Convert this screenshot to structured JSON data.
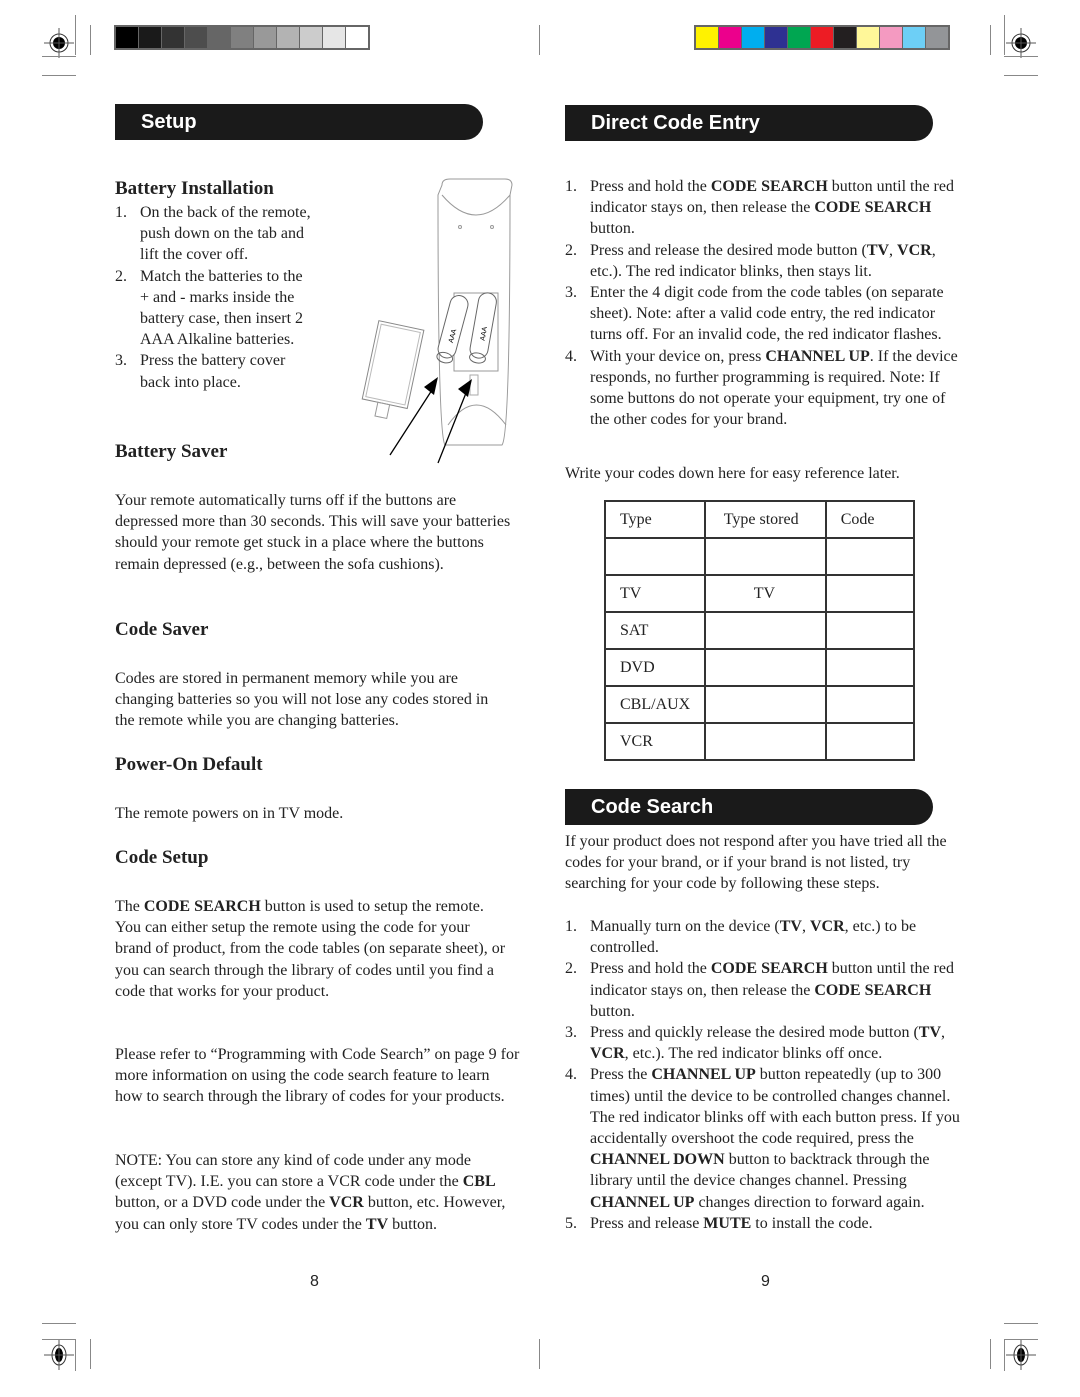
{
  "color_bars": {
    "grayscale": [
      "#000000",
      "#1a1a1a",
      "#333333",
      "#4d4d4d",
      "#666666",
      "#808080",
      "#999999",
      "#b3b3b3",
      "#cccccc",
      "#e6e6e6",
      "#ffffff"
    ],
    "process": [
      "#fff200",
      "#ec008c",
      "#00aeef",
      "#2e3192",
      "#00a651",
      "#ed1c24",
      "#231f20",
      "#fff799",
      "#f49ac1",
      "#6dcff6",
      "#939598"
    ]
  },
  "left_page": {
    "header": "Setup",
    "battery_installation": {
      "title": "Battery Installation",
      "steps": [
        {
          "num": "1.",
          "lines": [
            "On the back of the remote,",
            "push down on the tab and",
            "lift the cover off."
          ]
        },
        {
          "num": "2.",
          "lines": [
            "Match the batteries to the",
            "+ and - marks inside the",
            "battery case, then insert 2",
            "AAA Alkaline batteries."
          ]
        },
        {
          "num": "3.",
          "lines": [
            "Press the battery cover",
            "back into place."
          ]
        }
      ],
      "illustration": {
        "battery_label_1": "AAA",
        "battery_label_2": "AAA",
        "plus": "+",
        "minus": "–"
      }
    },
    "battery_saver": {
      "title": "Battery Saver",
      "text": "Your remote automatically turns off if the buttons are depressed more than 30 seconds. This will save your batteries should your remote get stuck in a place where the buttons remain depressed (e.g., between the sofa cushions)."
    },
    "code_saver": {
      "title": "Code Saver",
      "text": "Codes are stored in permanent memory while you are changing batteries so you will not lose any codes stored in the remote while you are changing batteries."
    },
    "power_on_default": {
      "title": "Power-On Default",
      "text": "The remote powers on in TV mode."
    },
    "code_setup": {
      "title": "Code Setup",
      "p1_pre": "The ",
      "p1_bold": "CODE SEARCH",
      "p1_post": " button is used to setup the remote. You can either setup the remote using the code for your brand of product, from the code tables (on separate sheet), or you can search through the library of codes until you find a code that works for your product.",
      "p2": "Please refer to “Programming with Code Search” on page 9 for more information on using the code search feature to learn how to search through the library of codes for your products.",
      "note_1": "NOTE: You can store any kind of code under any mode (except TV). I.E. you can store a VCR code under the ",
      "note_b1": "CBL",
      "note_2": " button, or a DVD code under the ",
      "note_b2": "VCR",
      "note_3": " button, etc. However, you can only store TV codes under the ",
      "note_b3": "TV",
      "note_4": " button."
    },
    "page_number": "8"
  },
  "right_page": {
    "header": "Direct Code Entry",
    "direct_steps": {
      "s1": {
        "num": "1.",
        "a": "Press and hold the ",
        "b1": "CODE SEARCH",
        "c": " button until the red indicator stays on, then release the ",
        "b2": "CODE SEARCH",
        "d": " button."
      },
      "s2": {
        "num": "2.",
        "a": "Press and release the desired mode button (",
        "b1": "TV",
        "c": ", ",
        "b2": "VCR",
        "d": ", etc.). The red indicator blinks, then stays lit."
      },
      "s3": {
        "num": "3.",
        "text": "Enter the 4 digit code from the code tables (on separate sheet). Note: after a valid code entry, the red indicator turns off.  For an invalid code, the red indicator flashes."
      },
      "s4": {
        "num": "4.",
        "a": "With your device on, press ",
        "b1": "CHANNEL UP",
        "c": ". If the device responds, no further programming is required. Note: If some buttons do not operate your equipment, try one of the other codes for your brand."
      }
    },
    "write_codes": "Write your codes down here for easy reference later.",
    "code_table": {
      "headers": [
        "Type",
        "Type  stored",
        "Code"
      ],
      "rows": [
        [
          "",
          "",
          ""
        ],
        [
          "TV",
          "TV",
          ""
        ],
        [
          "SAT",
          "",
          ""
        ],
        [
          "DVD",
          "",
          ""
        ],
        [
          "CBL/AUX",
          "",
          ""
        ],
        [
          "VCR",
          "",
          ""
        ]
      ]
    },
    "code_search": {
      "header": "Code Search",
      "intro": "If your product does not respond after you have tried all the codes for your brand, or if your brand is not listed, try searching for your code by following these steps.",
      "s1": {
        "num": "1.",
        "a": "Manually turn on the device (",
        "b1": "TV",
        "c": ", ",
        "b2": "VCR",
        "d": ", etc.) to be controlled."
      },
      "s2": {
        "num": "2.",
        "a": "Press and hold the ",
        "b1": "CODE SEARCH",
        "c": " button until the red indicator stays on, then release the ",
        "b2": "CODE SEARCH",
        "d": " button."
      },
      "s3": {
        "num": "3.",
        "a": "Press and quickly release the desired mode button (",
        "b1": "TV",
        "c": ", ",
        "b2": "VCR",
        "d": ", etc.). The red indicator blinks off once."
      },
      "s4": {
        "num": "4.",
        "a": "Press the ",
        "b1": "CHANNEL UP",
        "c": " button repeatedly (up to 300 times) until the device to be controlled changes channel. The red indicator blinks off with each button press.  If you accidentally overshoot the code required, press the ",
        "b2": "CHANNEL DOWN",
        "d": " button to backtrack through the library until the device changes channel. Pressing ",
        "b3": "CHANNEL UP",
        "e": " changes direction to forward again."
      },
      "s5": {
        "num": "5.",
        "a": "Press and release ",
        "b1": "MUTE",
        "c": " to install the code."
      }
    },
    "page_number": "9"
  }
}
